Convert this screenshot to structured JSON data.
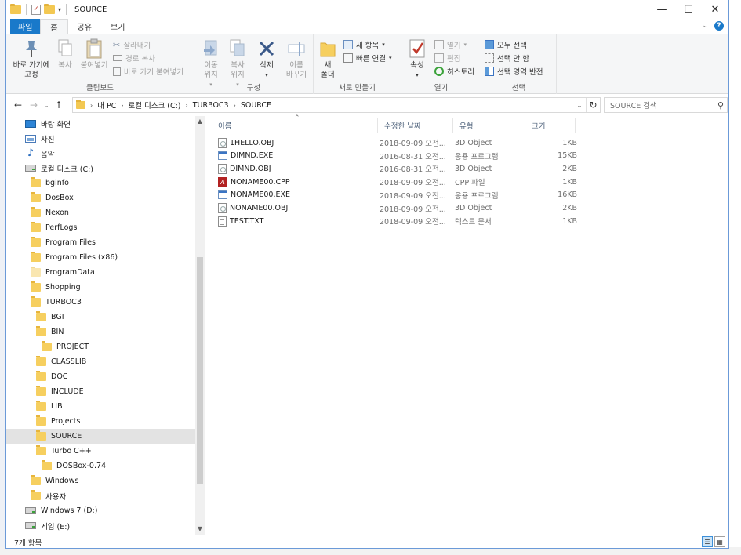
{
  "window": {
    "title": "SOURCE",
    "controls": {
      "minimize": "—",
      "maximize": "☐",
      "close": "✕"
    }
  },
  "ribbon_tabs": [
    "파일",
    "홈",
    "공유",
    "보기"
  ],
  "ribbon": {
    "clipboard": {
      "label": "클립보드",
      "pin": "바로 가기에\n고정",
      "copy": "복사",
      "paste": "붙여넣기",
      "cut": "잘라내기",
      "copy_path": "경로 복사",
      "paste_shortcut": "바로 가기 붙여넣기"
    },
    "organize": {
      "label": "구성",
      "move_to": "이동\n위치",
      "copy_to": "복사\n위치",
      "delete": "삭제",
      "rename": "이름\n바꾸기"
    },
    "new": {
      "label": "새로 만들기",
      "new_folder": "새\n폴더",
      "new_item": "새 항목",
      "easy_access": "빠른 연결"
    },
    "open": {
      "label": "열기",
      "properties": "속성",
      "open": "열기",
      "edit": "편집",
      "history": "히스토리"
    },
    "select": {
      "label": "선택",
      "select_all": "모두 선택",
      "select_none": "선택 안 함",
      "invert": "선택 영역 반전"
    }
  },
  "address": {
    "crumbs": [
      "내 PC",
      "로컬 디스크 (C:)",
      "TURBOC3",
      "SOURCE"
    ],
    "search_placeholder": "SOURCE 검색"
  },
  "tree": [
    {
      "label": "바탕 화면",
      "icon": "desktop-icon",
      "indent": 0
    },
    {
      "label": "사진",
      "icon": "pictures-icon",
      "indent": 0
    },
    {
      "label": "음악",
      "icon": "music-icon",
      "indent": 0
    },
    {
      "label": "로컬 디스크 (C:)",
      "icon": "drive-icon",
      "indent": 0
    },
    {
      "label": "bginfo",
      "icon": "folder-icon",
      "indent": 1
    },
    {
      "label": "DosBox",
      "icon": "folder-icon",
      "indent": 1
    },
    {
      "label": "Nexon",
      "icon": "folder-icon",
      "indent": 1
    },
    {
      "label": "PerfLogs",
      "icon": "folder-icon",
      "indent": 1
    },
    {
      "label": "Program Files",
      "icon": "folder-icon",
      "indent": 1
    },
    {
      "label": "Program Files (x86)",
      "icon": "folder-icon",
      "indent": 1
    },
    {
      "label": "ProgramData",
      "icon": "folder-light-icon",
      "indent": 1
    },
    {
      "label": "Shopping",
      "icon": "folder-icon",
      "indent": 1
    },
    {
      "label": "TURBOC3",
      "icon": "folder-icon",
      "indent": 1
    },
    {
      "label": "BGI",
      "icon": "folder-icon",
      "indent": 2
    },
    {
      "label": "BIN",
      "icon": "folder-icon",
      "indent": 2
    },
    {
      "label": "PROJECT",
      "icon": "folder-icon",
      "indent": 3
    },
    {
      "label": "CLASSLIB",
      "icon": "folder-icon",
      "indent": 2
    },
    {
      "label": "DOC",
      "icon": "folder-icon",
      "indent": 2
    },
    {
      "label": "INCLUDE",
      "icon": "folder-icon",
      "indent": 2
    },
    {
      "label": "LIB",
      "icon": "folder-icon",
      "indent": 2
    },
    {
      "label": "Projects",
      "icon": "folder-icon",
      "indent": 2
    },
    {
      "label": "SOURCE",
      "icon": "folder-icon",
      "indent": 2,
      "selected": true
    },
    {
      "label": "Turbo C++",
      "icon": "folder-icon",
      "indent": 2
    },
    {
      "label": "DOSBox-0.74",
      "icon": "folder-icon",
      "indent": 3
    },
    {
      "label": "Windows",
      "icon": "folder-icon",
      "indent": 1
    },
    {
      "label": "사용자",
      "icon": "folder-icon",
      "indent": 1
    },
    {
      "label": "Windows 7 (D:)",
      "icon": "drive-icon",
      "indent": 0
    },
    {
      "label": "게임 (E:)",
      "icon": "drive-icon",
      "indent": 0
    }
  ],
  "columns": {
    "name": "이름",
    "date": "수정한 날짜",
    "type": "유형",
    "size": "크기"
  },
  "files": [
    {
      "name": "1HELLO.OBJ",
      "date": "2018-09-09 오전...",
      "type": "3D Object",
      "size": "1KB",
      "icon": "obj"
    },
    {
      "name": "DIMND.EXE",
      "date": "2016-08-31 오전...",
      "type": "응용 프로그램",
      "size": "15KB",
      "icon": "exe"
    },
    {
      "name": "DIMND.OBJ",
      "date": "2016-08-31 오전...",
      "type": "3D Object",
      "size": "2KB",
      "icon": "obj"
    },
    {
      "name": "NONAME00.CPP",
      "date": "2018-09-09 오전...",
      "type": "CPP 파일",
      "size": "1KB",
      "icon": "cpp"
    },
    {
      "name": "NONAME00.EXE",
      "date": "2018-09-09 오전...",
      "type": "응용 프로그램",
      "size": "16KB",
      "icon": "exe"
    },
    {
      "name": "NONAME00.OBJ",
      "date": "2018-09-09 오전...",
      "type": "3D Object",
      "size": "2KB",
      "icon": "obj"
    },
    {
      "name": "TEST.TXT",
      "date": "2018-09-09 오전...",
      "type": "텍스트 문서",
      "size": "1KB",
      "icon": "txt"
    }
  ],
  "status": {
    "item_count": "7개 항목"
  },
  "colors": {
    "accent": "#1979ca",
    "selection": "#e3e3e3",
    "folder": "#f6cf5f"
  }
}
